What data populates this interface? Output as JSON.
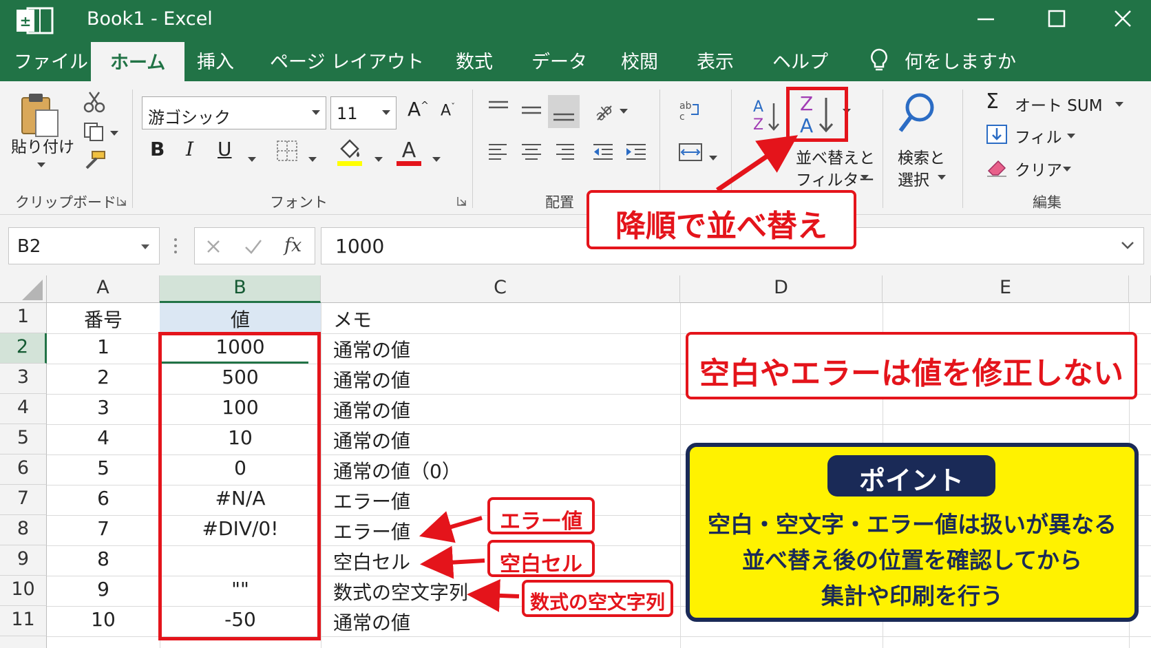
{
  "window": {
    "title": "Book1  -  Excel"
  },
  "menu": {
    "tabs": [
      "ファイル",
      "ホーム",
      "挿入",
      "ページ レイアウト",
      "数式",
      "データ",
      "校閲",
      "表示",
      "ヘルプ"
    ],
    "active_tab": "ホーム",
    "tell_me": "何をしますか"
  },
  "ribbon": {
    "clipboard": {
      "paste_label": "貼り付け",
      "group_label": "クリップボード"
    },
    "font": {
      "name": "游ゴシック",
      "size": "11",
      "group_label": "フォント",
      "bold": "B",
      "italic": "I",
      "underline": "U"
    },
    "alignment": {
      "group_label": "配置"
    },
    "sort_filter": {
      "label_line1": "並べ替えと",
      "label_line2": "フィルター"
    },
    "find_select": {
      "label_line1": "検索と",
      "label_line2": "選択"
    },
    "editing": {
      "autosum": "オート SUM",
      "fill": "フィル",
      "clear": "クリア",
      "group_label": "編集"
    }
  },
  "formula_bar": {
    "name_box": "B2",
    "value": "1000",
    "fx": "fx"
  },
  "grid": {
    "columns": [
      "A",
      "B",
      "C",
      "D",
      "E"
    ],
    "selected_column": "B",
    "selected_row": 2,
    "rows": [
      {
        "n": "1",
        "a": "番号",
        "b": "値",
        "c": "メモ"
      },
      {
        "n": "2",
        "a": "1",
        "b": "1000",
        "c": "通常の値"
      },
      {
        "n": "3",
        "a": "2",
        "b": "500",
        "c": "通常の値"
      },
      {
        "n": "4",
        "a": "3",
        "b": "100",
        "c": "通常の値"
      },
      {
        "n": "5",
        "a": "4",
        "b": "10",
        "c": "通常の値"
      },
      {
        "n": "6",
        "a": "5",
        "b": "0",
        "c": "通常の値（0）"
      },
      {
        "n": "7",
        "a": "6",
        "b": "#N/A",
        "c": "エラー値"
      },
      {
        "n": "8",
        "a": "7",
        "b": "#DIV/0!",
        "c": "エラー値"
      },
      {
        "n": "9",
        "a": "8",
        "b": "",
        "c": "空白セル"
      },
      {
        "n": "10",
        "a": "9",
        "b": "\"\"",
        "c": "数式の空文字列"
      },
      {
        "n": "11",
        "a": "10",
        "b": "-50",
        "c": "通常の値"
      }
    ]
  },
  "annotations": {
    "descending_sort": "降順で並べ替え",
    "warning": "空白やエラーは値を修正しない",
    "error_value": "エラー値",
    "blank_cell": "空白セル",
    "empty_string": "数式の空文字列",
    "point": {
      "title": "ポイント",
      "lines": [
        "空白・空文字・エラー値は扱いが異なる",
        "並べ替え後の位置を確認してから",
        "集計や印刷を行う"
      ]
    }
  },
  "colors": {
    "excel_green": "#217346",
    "annotation_red": "#e4141b",
    "point_yellow": "#fff200",
    "point_navy": "#1a2a57"
  }
}
